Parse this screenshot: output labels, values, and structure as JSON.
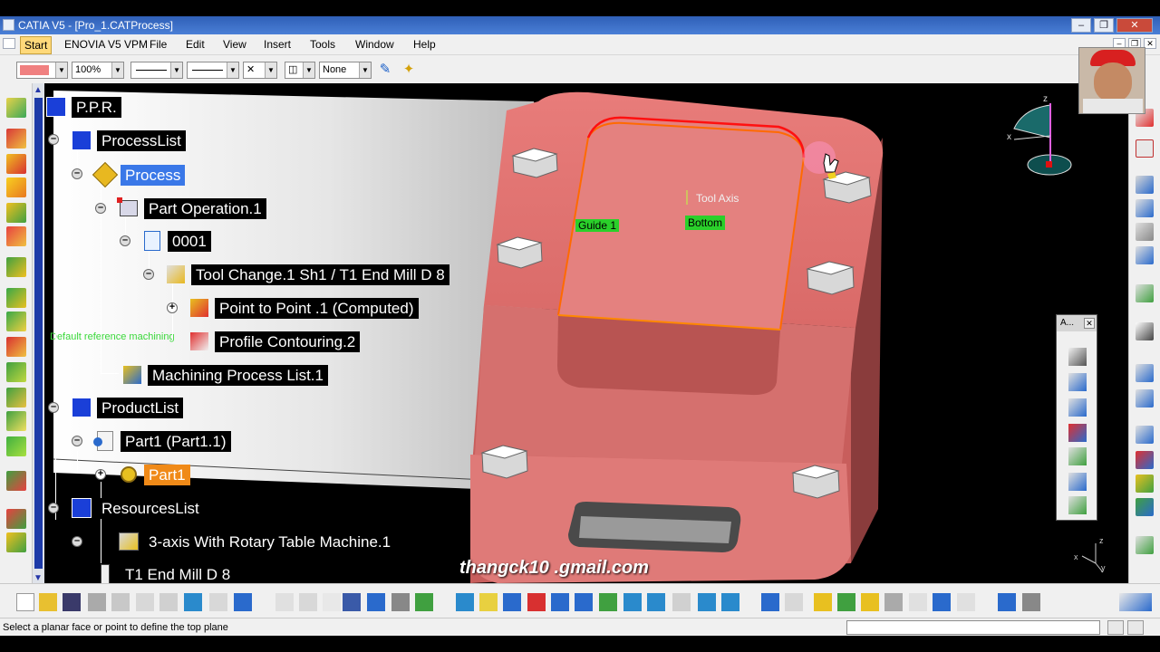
{
  "window": {
    "title": "CATIA V5 - [Pro_1.CATProcess]",
    "minimize": "–",
    "restore": "❐",
    "close": "✕"
  },
  "menu": {
    "items": [
      "Start",
      "ENOVIA V5 VPM",
      "File",
      "Edit",
      "View",
      "Insert",
      "Tools",
      "Window",
      "Help"
    ]
  },
  "properties_toolbar": {
    "line_weight_percent": "100%",
    "layer": "None"
  },
  "tree": {
    "root": "P.P.R.",
    "process_list": "ProcessList",
    "process": "Process",
    "part_operation": "Part Operation.1",
    "program": "0001",
    "tool_change": "Tool Change.1  Sh1 / T1 End Mill D 8",
    "point_to_point": "Point to Point .1 (Computed)",
    "profile_contouring": "Profile Contouring.2",
    "machining_process_list": "Machining Process List.1",
    "product_list": "ProductList",
    "part_instance": "Part1 (Part1.1)",
    "part": "Part1",
    "resources_list": "ResourcesList",
    "machine": "3-axis With Rotary Table Machine.1",
    "tool": "T1 End Mill D 8"
  },
  "viewport": {
    "default_ref_label": "Default reference machining",
    "tool_axis_label": "Tool Axis",
    "guide_label": "Guide 1",
    "bottom_label": "Bottom",
    "watermark": "thangck10 .gmail.com",
    "model_color": "#e07a78",
    "axis_z": "z",
    "axis_x": "x",
    "axis_y": "y"
  },
  "floating_toolbar": {
    "title": "A..."
  },
  "status_bar": {
    "message": "Select a planar face or point to define the top plane"
  },
  "colors": {
    "selected_tree_item": "#3a78e8",
    "highlighted_part": "#f08a18",
    "title_bar": "#2f5fb7"
  }
}
